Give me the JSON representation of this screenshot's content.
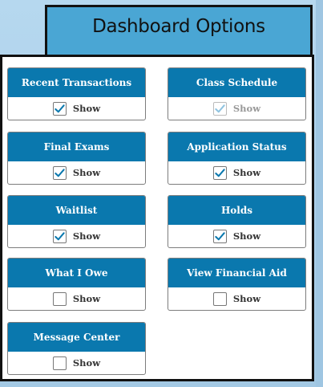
{
  "header": {
    "title": "Dashboard Options"
  },
  "colors": {
    "card_header": "#0a78ae",
    "check": "#0a78ae",
    "header_tab": "#4aa6d4"
  },
  "options": [
    {
      "title": "Recent Transactions",
      "show_label": "Show",
      "checked": true,
      "disabled": false
    },
    {
      "title": "Class Schedule",
      "show_label": "Show",
      "checked": true,
      "disabled": true
    },
    {
      "title": "Final Exams",
      "show_label": "Show",
      "checked": true,
      "disabled": false
    },
    {
      "title": "Application Status",
      "show_label": "Show",
      "checked": true,
      "disabled": false
    },
    {
      "title": "Waitlist",
      "show_label": "Show",
      "checked": true,
      "disabled": false
    },
    {
      "title": "Holds",
      "show_label": "Show",
      "checked": true,
      "disabled": false
    },
    {
      "title": "What I Owe",
      "show_label": "Show",
      "checked": false,
      "disabled": false
    },
    {
      "title": "View Financial Aid",
      "show_label": "Show",
      "checked": false,
      "disabled": false
    },
    {
      "title": "Message Center",
      "show_label": "Show",
      "checked": false,
      "disabled": false
    }
  ]
}
